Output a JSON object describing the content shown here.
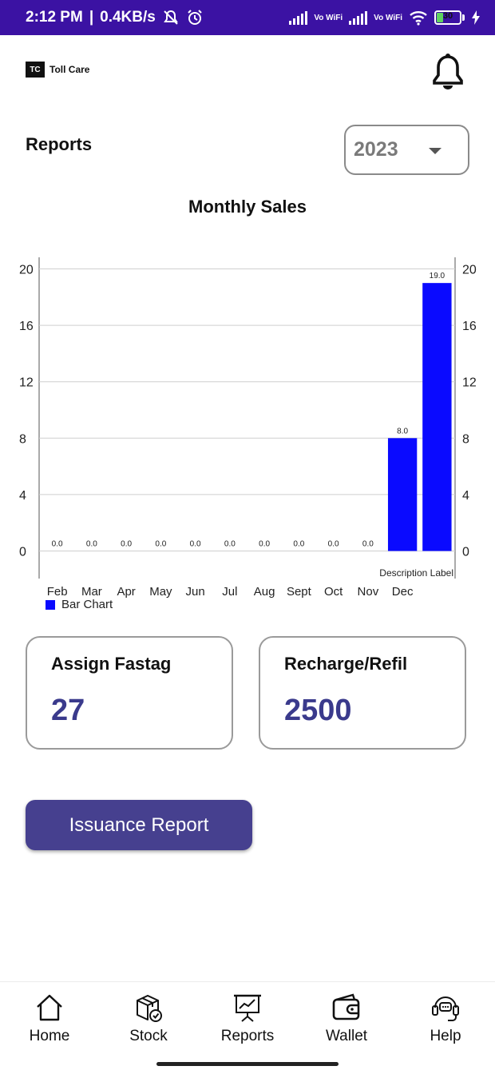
{
  "status_bar": {
    "time": "2:12 PM",
    "net_speed": "0.4KB/s",
    "vowifi_1": "Vo WiFi",
    "vowifi_2": "Vo WiFi",
    "battery": "30",
    "battery_level": 0.3
  },
  "header": {
    "logo_badge": "TC",
    "logo_text": "Toll Care"
  },
  "page_title": "Reports",
  "year_select": {
    "value": "2023"
  },
  "chart_title": "Monthly Sales",
  "chart_data": {
    "type": "bar",
    "title": "Monthly Sales",
    "categories": [
      "Feb",
      "Mar",
      "Apr",
      "May",
      "Jun",
      "Jul",
      "Aug",
      "Sept",
      "Oct",
      "Nov",
      "Dec"
    ],
    "series": [
      {
        "name": "Bar Chart",
        "values": [
          0,
          0,
          0,
          0,
          0,
          0,
          0,
          0,
          0,
          0,
          8,
          19
        ]
      }
    ],
    "value_labels": [
      "0.0",
      "0.0",
      "0.0",
      "0.0",
      "0.0",
      "0.0",
      "0.0",
      "0.0",
      "0.0",
      "0.0",
      "8.0",
      "19.0"
    ],
    "y_ticks": [
      "0",
      "4",
      "8",
      "12",
      "16",
      "20"
    ],
    "ylim": [
      0,
      20
    ],
    "description_label": "Description Label",
    "grid": true,
    "legend_position": "bottom-left",
    "bar_color": "#0a0aff"
  },
  "legend": {
    "label": "Bar Chart"
  },
  "cards": {
    "assign_fastag": {
      "label": "Assign Fastag",
      "value": "27"
    },
    "recharge": {
      "label": "Recharge/Refil",
      "value": "2500"
    }
  },
  "issuance_button": "Issuance Report",
  "nav": {
    "home": "Home",
    "stock": "Stock",
    "reports": "Reports",
    "wallet": "Wallet",
    "help": "Help"
  },
  "colors": {
    "status_bar": "#3b12a3",
    "accent": "#46408f",
    "card_value": "#3a3a8c"
  }
}
